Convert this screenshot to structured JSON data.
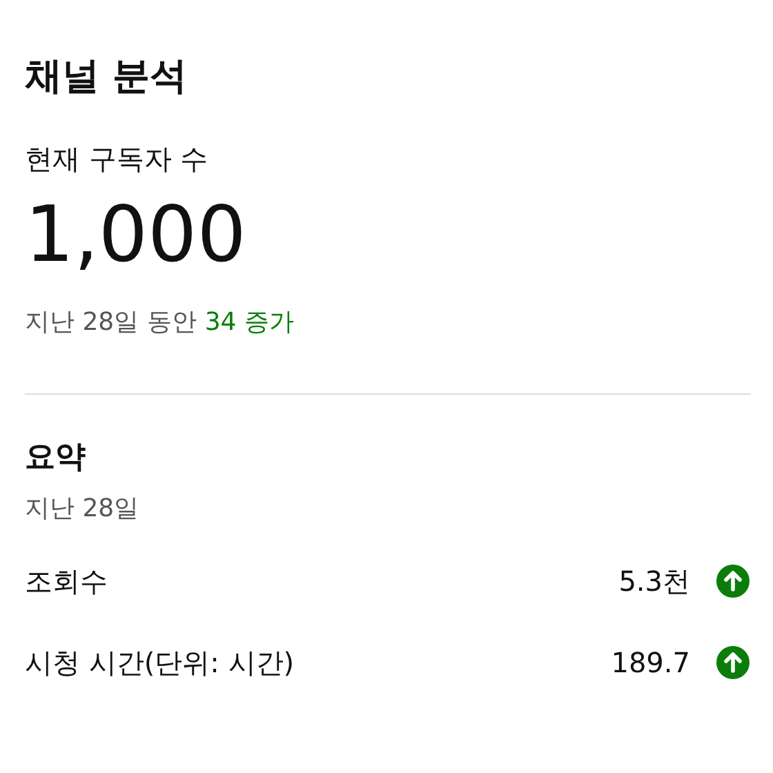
{
  "title": "채널 분석",
  "subscribers": {
    "label": "현재 구독자 수",
    "value": "1,000",
    "period": "지난 28일 동안",
    "change": "34 증가"
  },
  "summary": {
    "title": "요약",
    "period": "지난 28일",
    "metrics": [
      {
        "label": "조회수",
        "value": "5.3천",
        "increased": true
      },
      {
        "label": "시청 시간(단위: 시간)",
        "value": "189.7",
        "increased": true
      }
    ]
  }
}
